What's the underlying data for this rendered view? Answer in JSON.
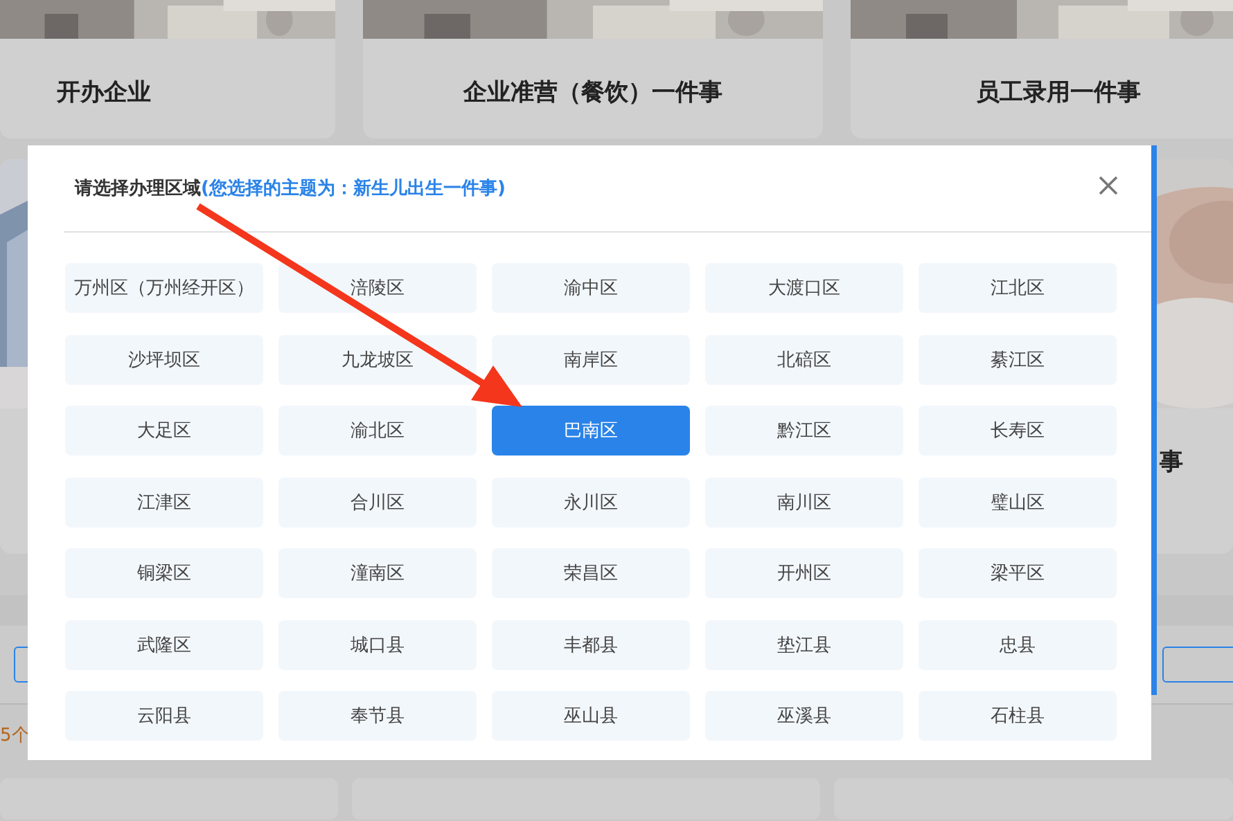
{
  "background": {
    "top_cards": [
      {
        "title": "开办企业"
      },
      {
        "title": "企业准营（餐饮）一件事"
      },
      {
        "title": "员工录用一件事"
      }
    ],
    "middle_title_fragment": "事",
    "count_fragment": "5个"
  },
  "dialog": {
    "title": "请选择办理区域",
    "subtitle": "(您选择的主题为：新生儿出生一件事)",
    "districts": [
      {
        "name": "万州区（万州经开区）",
        "selected": false
      },
      {
        "name": "涪陵区",
        "selected": false
      },
      {
        "name": "渝中区",
        "selected": false
      },
      {
        "name": "大渡口区",
        "selected": false
      },
      {
        "name": "江北区",
        "selected": false
      },
      {
        "name": "沙坪坝区",
        "selected": false
      },
      {
        "name": "九龙坡区",
        "selected": false
      },
      {
        "name": "南岸区",
        "selected": false
      },
      {
        "name": "北碚区",
        "selected": false
      },
      {
        "name": "綦江区",
        "selected": false
      },
      {
        "name": "大足区",
        "selected": false
      },
      {
        "name": "渝北区",
        "selected": false
      },
      {
        "name": "巴南区",
        "selected": true
      },
      {
        "name": "黔江区",
        "selected": false
      },
      {
        "name": "长寿区",
        "selected": false
      },
      {
        "name": "江津区",
        "selected": false
      },
      {
        "name": "合川区",
        "selected": false
      },
      {
        "name": "永川区",
        "selected": false
      },
      {
        "name": "南川区",
        "selected": false
      },
      {
        "name": "璧山区",
        "selected": false
      },
      {
        "name": "铜梁区",
        "selected": false
      },
      {
        "name": "潼南区",
        "selected": false
      },
      {
        "name": "荣昌区",
        "selected": false
      },
      {
        "name": "开州区",
        "selected": false
      },
      {
        "name": "梁平区",
        "selected": false
      },
      {
        "name": "武隆区",
        "selected": false
      },
      {
        "name": "城口县",
        "selected": false
      },
      {
        "name": "丰都县",
        "selected": false
      },
      {
        "name": "垫江县",
        "selected": false
      },
      {
        "name": "忠县",
        "selected": false
      },
      {
        "name": "云阳县",
        "selected": false
      },
      {
        "name": "奉节县",
        "selected": false
      },
      {
        "name": "巫山县",
        "selected": false
      },
      {
        "name": "巫溪县",
        "selected": false
      },
      {
        "name": "石柱县",
        "selected": false
      }
    ]
  }
}
